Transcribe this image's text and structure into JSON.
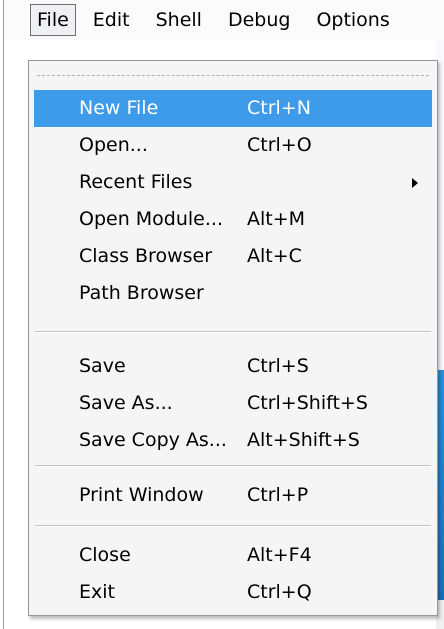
{
  "menubar": {
    "items": [
      "File",
      "Edit",
      "Shell",
      "Debug",
      "Options"
    ]
  },
  "file_menu": {
    "items": [
      {
        "label": "New File",
        "accel": "Ctrl+N",
        "highlighted": true
      },
      {
        "label": "Open...",
        "accel": "Ctrl+O"
      },
      {
        "label": "Recent Files",
        "accel": "",
        "submenu": true
      },
      {
        "label": "Open Module...",
        "accel": "Alt+M"
      },
      {
        "label": "Class Browser",
        "accel": "Alt+C"
      },
      {
        "label": "Path Browser",
        "accel": ""
      },
      {
        "label": "Save",
        "accel": "Ctrl+S"
      },
      {
        "label": "Save As...",
        "accel": "Ctrl+Shift+S"
      },
      {
        "label": "Save Copy As...",
        "accel": "Alt+Shift+S"
      },
      {
        "label": "Print Window",
        "accel": "Ctrl+P"
      },
      {
        "label": "Close",
        "accel": "Alt+F4"
      },
      {
        "label": "Exit",
        "accel": "Ctrl+Q"
      }
    ]
  },
  "colors": {
    "highlight": "#3d9bea",
    "menu_bg": "#f5f5f5"
  }
}
